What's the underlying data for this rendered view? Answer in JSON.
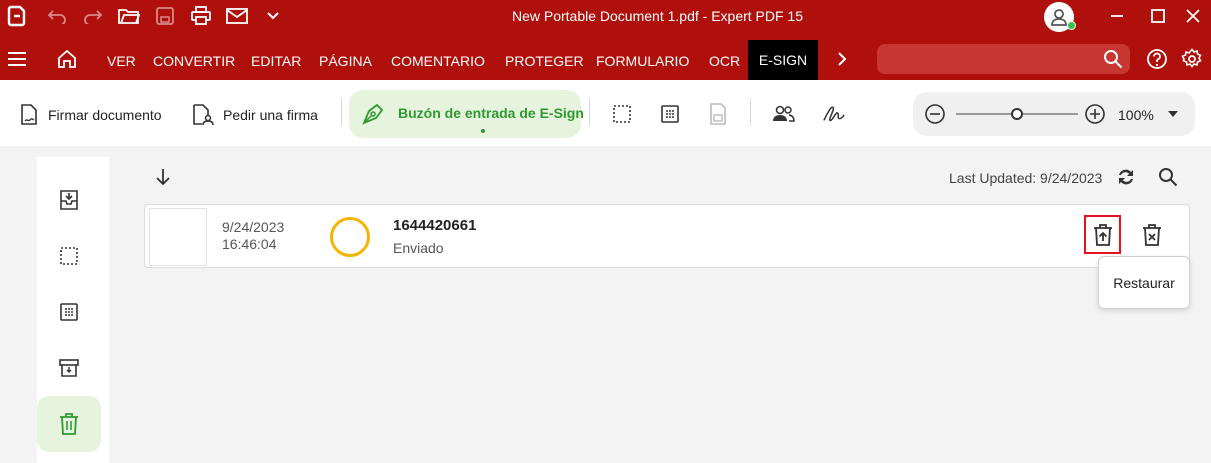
{
  "window": {
    "title": "New Portable Document 1.pdf   -   Expert PDF 15"
  },
  "titlebar": {
    "icons": [
      "app-logo-icon",
      "undo-icon",
      "redo-icon",
      "open-folder-icon",
      "save-icon",
      "print-icon",
      "email-icon",
      "chevron-down-icon"
    ],
    "controls": [
      "minimize-icon",
      "maximize-icon",
      "close-icon"
    ]
  },
  "menu": {
    "items": [
      "VER",
      "CONVERTIR",
      "EDITAR",
      "PÁGINA",
      "COMENTARIO",
      "PROTEGER",
      "FORMULARIO",
      "OCR"
    ],
    "active": "E-SIGN",
    "search_placeholder": ""
  },
  "toolbar": {
    "sign_document": "Firmar documento",
    "request_signature": "Pedir una firma",
    "inbox": "Buzón de entrada de E-Sign",
    "zoom": "100%"
  },
  "main": {
    "last_updated": "Last Updated: 9/24/2023",
    "rows": [
      {
        "date": "9/24/2023",
        "time": "16:46:04",
        "id": "1644420661",
        "status": "Enviado",
        "status_color": "#f4b400"
      }
    ],
    "tooltip": "Restaurar"
  },
  "colors": {
    "brand": "#b0100c",
    "accent_green": "#2e9a2f",
    "highlight_red": "#e1131e"
  }
}
